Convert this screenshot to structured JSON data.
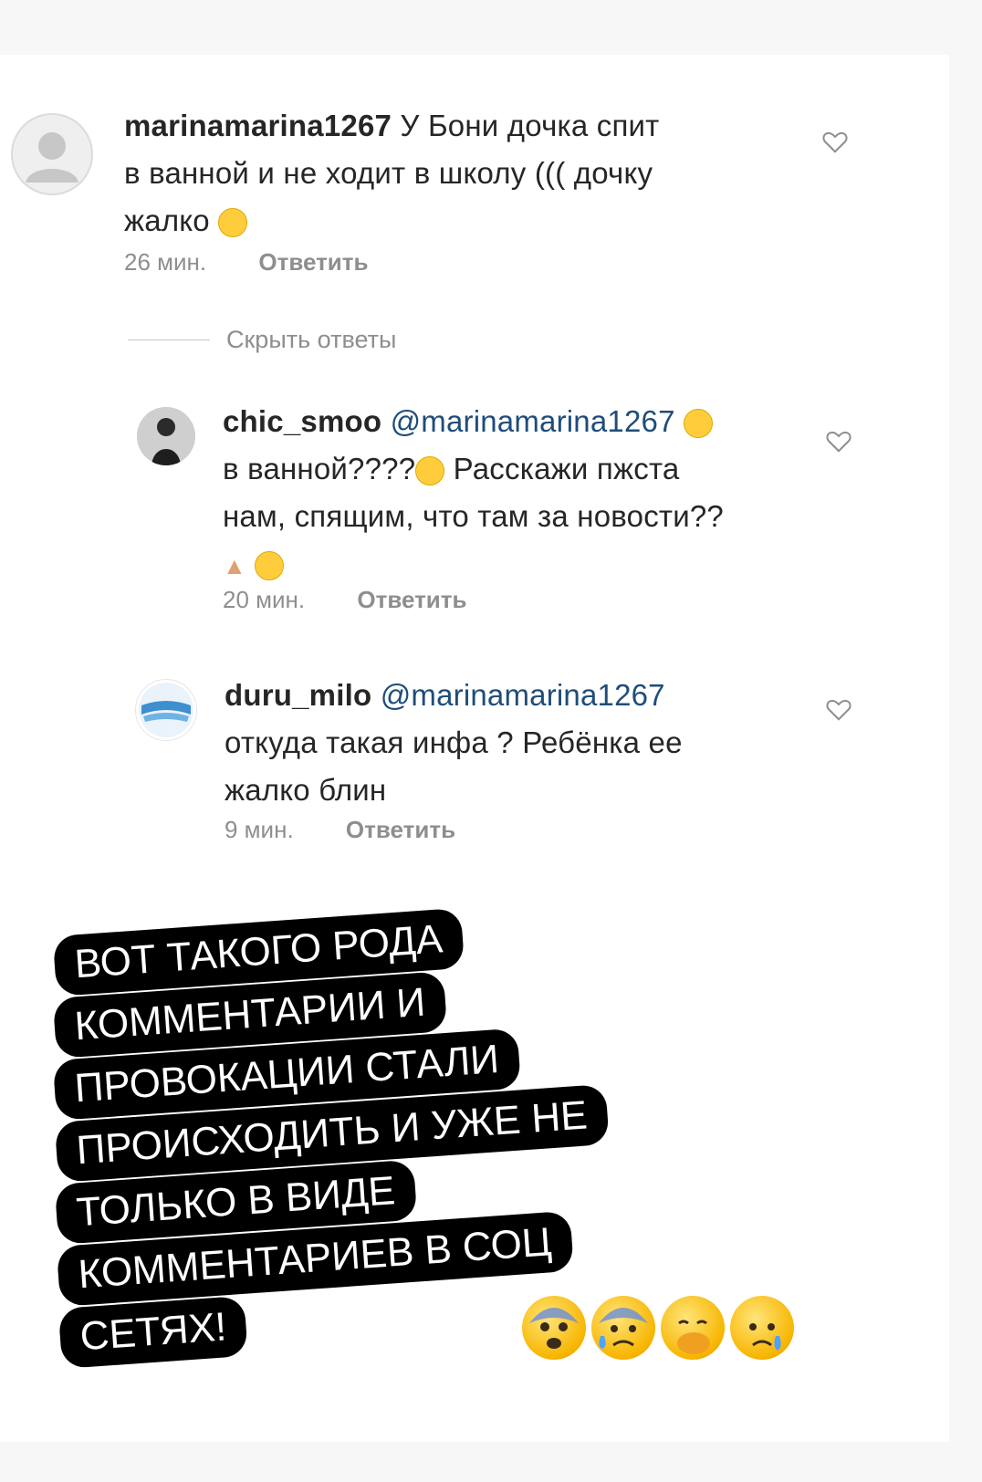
{
  "comments": [
    {
      "username": "marinamarina1267",
      "text": "У Бони дочка спит в ванной и не ходит в школу ((( дочку жалко",
      "line1": "У Бони дочка спит",
      "line2": "в ванной и не ходит в школу ((( дочку",
      "line3": "жалко",
      "emoji": "weary-face",
      "time": "26 мин.",
      "reply_label": "Ответить"
    },
    {
      "username": "chic_smoo",
      "mention": "@marinamarina1267",
      "line2": "в ванной????",
      "line2b": " Расскажи пжста",
      "line3": "нам, спящим, что там за новости??",
      "emojis": [
        "flushed-face",
        "tears-of-joy-face",
        "folded-hands",
        "tears-of-joy-face"
      ],
      "time": "20 мин.",
      "reply_label": "Ответить"
    },
    {
      "username": "duru_milo",
      "mention": "@marinamarina1267",
      "line2": "откуда такая инфа ? Ребёнка ее",
      "line3": "жалко блин",
      "time": "9 мин.",
      "reply_label": "Ответить"
    }
  ],
  "hide_replies_label": "Скрыть ответы",
  "caption_lines": [
    "ВОТ ТАКОГО РОДА",
    "КОММЕНТАРИИ И",
    "ПРОВОКАЦИИ СТАЛИ",
    "ПРОИСХОДИТЬ И УЖЕ НЕ",
    "ТОЛЬКО В ВИДЕ",
    "КОММЕНТАРИЕВ В СОЦ",
    "СЕТЯХ!"
  ],
  "caption_emojis": [
    "fearful-face",
    "anxious-face-with-sweat",
    "face-with-hand-over-mouth",
    "sad-but-relieved-face"
  ],
  "colors": {
    "text": "#262626",
    "meta": "#8e8e8e",
    "caption_bg": "#000000",
    "caption_text": "#ffffff"
  }
}
